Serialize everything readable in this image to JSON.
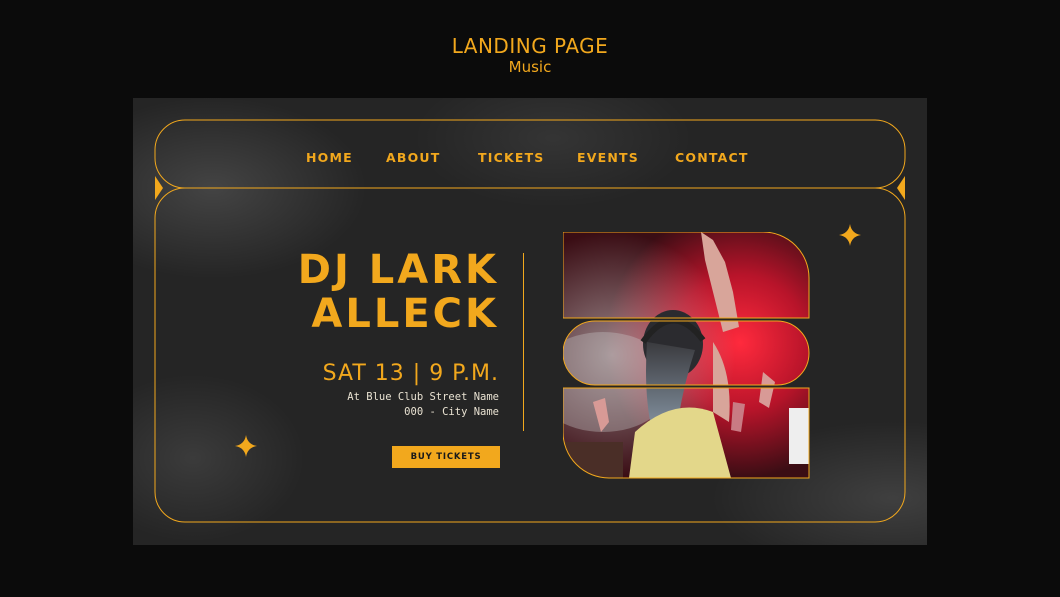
{
  "header": {
    "title": "LANDING PAGE",
    "subtitle": "Music"
  },
  "nav": {
    "items": [
      {
        "label": "HOME"
      },
      {
        "label": "ABOUT"
      },
      {
        "label": "TICKETS"
      },
      {
        "label": "EVENTS"
      },
      {
        "label": "CONTACT"
      }
    ]
  },
  "hero": {
    "headline_line1": "DJ LARK",
    "headline_line2": "ALLECK",
    "date": "SAT 13 | 9 P.M.",
    "address_line1": "At Blue Club Street Name",
    "address_line2": "000 - City Name",
    "cta_label": "BUY TICKETS"
  },
  "colors": {
    "accent": "#f2a81d",
    "background": "#0b0b0b",
    "panel": "#252525"
  }
}
